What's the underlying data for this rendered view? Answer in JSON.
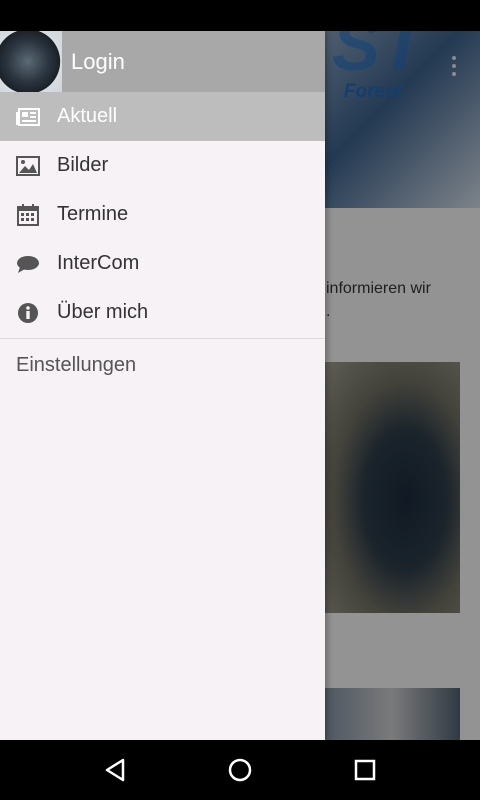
{
  "background_app": {
    "banner_text": "Forest",
    "content_text_line1": "informieren wir",
    "content_text_line2": "."
  },
  "drawer": {
    "header": {
      "title": "Login"
    },
    "items": [
      {
        "label": "Aktuell",
        "icon": "newspaper-icon",
        "active": true
      },
      {
        "label": "Bilder",
        "icon": "image-icon",
        "active": false
      },
      {
        "label": "Termine",
        "icon": "calendar-icon",
        "active": false
      },
      {
        "label": "InterCom",
        "icon": "chat-bubble-icon",
        "active": false
      },
      {
        "label": "Über mich",
        "icon": "info-icon",
        "active": false
      }
    ],
    "settings_label": "Einstellungen"
  },
  "system_nav": {
    "back": "back-icon",
    "home": "home-icon",
    "recents": "recents-icon"
  },
  "colors": {
    "drawer_bg": "#f6f2f6",
    "active_item_bg": "#bdbdbd",
    "header_bg": "#a8a8a8"
  }
}
